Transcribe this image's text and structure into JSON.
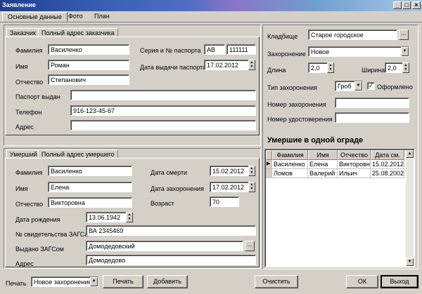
{
  "window": {
    "title": "Заявление",
    "min": "_",
    "max": "□",
    "close": "×"
  },
  "main_tabs": [
    "Основные данные",
    "Фото",
    "План"
  ],
  "customer": {
    "tabs": [
      "Заказчик",
      "Полный адрес заказчика"
    ],
    "surname_label": "Фамилия",
    "surname": "Василенко",
    "name_label": "Имя",
    "name": "Роман",
    "patronymic_label": "Отчество",
    "patronymic": "Степанович",
    "passport_label": "Серия и № паспорта",
    "passport_series": "АВ",
    "passport_number": "111111",
    "passport_date_label": "Дата выдачи паспорта",
    "passport_date": "17.02.2012",
    "issued_label": "Паспорт выдан",
    "issued": "",
    "phone_label": "Телефон",
    "phone": "916-123-45-67",
    "address_label": "Адрес",
    "address": ""
  },
  "deceased": {
    "tabs": [
      "Умерший",
      "Полный адрес умершего"
    ],
    "surname_label": "Фамилия",
    "surname": "Василенко",
    "name_label": "Имя",
    "name": "Елена",
    "patronymic_label": "Отчество",
    "patronymic": "Викторовна",
    "death_label": "Дата смерти",
    "death_date": "15.02.2012",
    "burial_label": "Дата захоронения",
    "burial_date": "17.02.2012",
    "age_label": "Возраст",
    "age": "70",
    "birth_label": "Дата рождения",
    "birth_date": "13.06.1942",
    "cert_label": "№ свидетельства ЗАГСа",
    "cert": "ВА 2345469",
    "zags_label": "Выдано ЗАГСом",
    "zags": "Домодедовский",
    "address_label": "Адрес",
    "address": "Домодедово"
  },
  "burial": {
    "cemetery_label": "Кладбище",
    "cemetery": "Старое городское",
    "type_label": "Захоронение",
    "type": "Новое",
    "length_label": "Длина",
    "length": "2,0",
    "width_label": "Ширина",
    "width": "2,0",
    "kind_label": "Тип захоронения",
    "kind": "Гроб",
    "registered_label": "Оформлено",
    "registered_mark": "✓",
    "number_label": "Номер захоронения",
    "number": "",
    "cert_label": "Номер удостоверения",
    "cert": ""
  },
  "fence": {
    "title": "Умершие в одной ограде",
    "columns": [
      "Фамилия",
      "Имя",
      "Отчество",
      "Дата см."
    ],
    "rows": [
      [
        "Василенко",
        "Елена",
        "Викторовна",
        "15.02.2012"
      ],
      [
        "Ломов",
        "Валерий",
        "Ильич",
        "25.08.2002"
      ]
    ],
    "row_marker": "▶"
  },
  "bottom": {
    "print_label": "Печать",
    "print_select": "Новое захоронение",
    "print_button": "Печать",
    "add_button": "Добавить",
    "clear_button": "Очистить",
    "ok_button": "ОК",
    "exit_button": "Выход"
  }
}
